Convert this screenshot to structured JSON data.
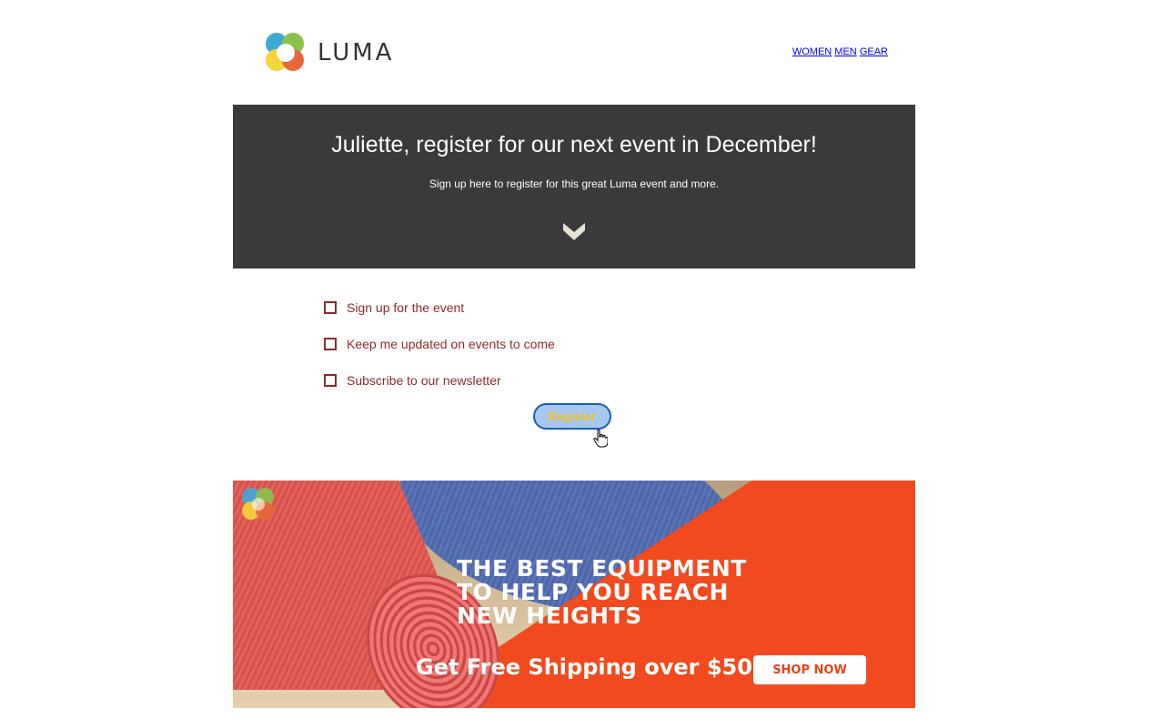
{
  "brand": {
    "name": "LUMA"
  },
  "nav": {
    "women": "WOMEN",
    "men": "MEN",
    "gear": "GEAR"
  },
  "hero": {
    "title": "Juliette, register for our next event in December!",
    "subtitle": "Sign up here to register for this great Luma event and more.",
    "icon": "chevron-down-icon"
  },
  "form": {
    "options": [
      {
        "label": "Sign up for the event",
        "checked": false
      },
      {
        "label": "Keep me updated on events to come",
        "checked": false
      },
      {
        "label": "Subscribe to our newsletter",
        "checked": false
      }
    ],
    "register_label": "Register"
  },
  "banner": {
    "headline": [
      "THE BEST EQUIPMENT",
      "TO HELP YOU REACH",
      "NEW HEIGHTS"
    ],
    "shipping": "Get Free Shipping over $50",
    "cta": "SHOP NOW"
  },
  "colors": {
    "hero_bg": "#3a3a3a",
    "checkbox_text": "#8b2a2a",
    "link": "#0000ee",
    "banner_orange": "#f04a1e",
    "register_bg": "#a6c8ef",
    "register_text": "#f0c020"
  }
}
